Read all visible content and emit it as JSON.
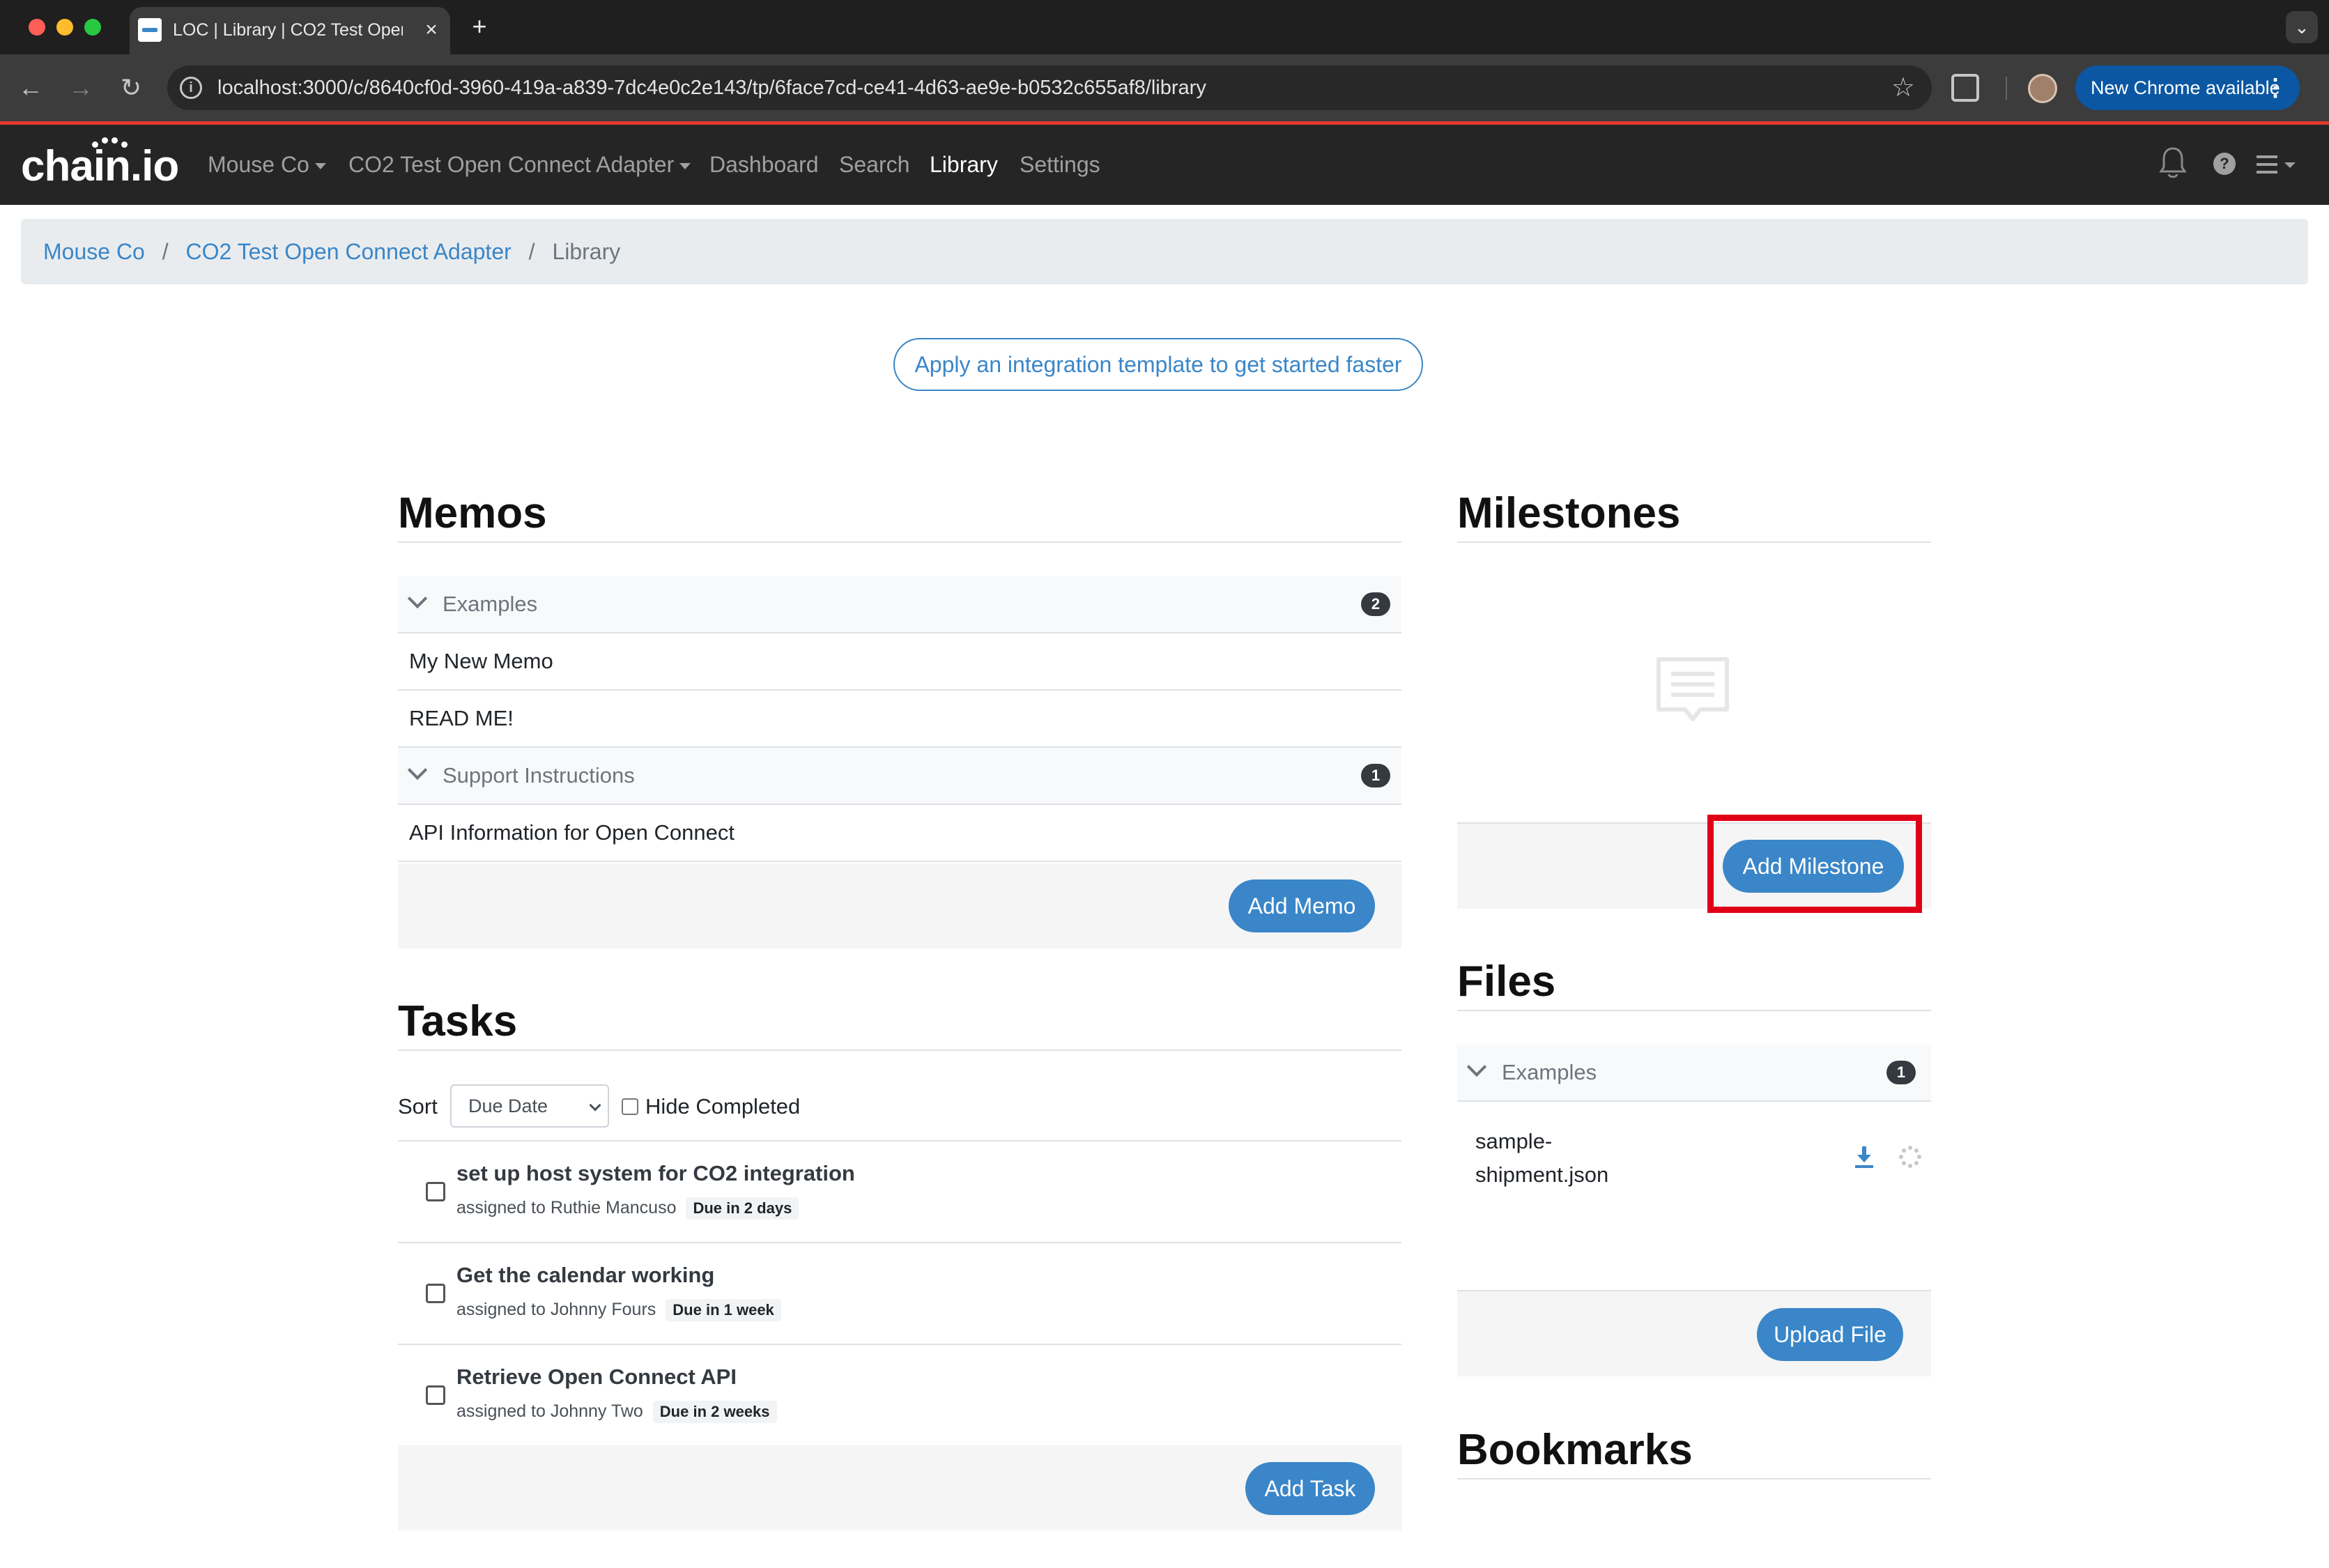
{
  "browser": {
    "tab_title": "LOC | Library | CO2 Test Open Connect Adapter",
    "tab_close": "×",
    "new_tab": "+",
    "tab_search": "⌄",
    "url": "localhost:3000/c/8640cf0d-3960-419a-a839-7dc4e0c2e143/tp/6face7cd-ce41-4d63-ae9e-b0532c655af8/library",
    "new_chrome_label": "New Chrome available",
    "new_chrome_dots": "⋮"
  },
  "navbar": {
    "logo": "chain.io",
    "company": "Mouse Co",
    "partner": "CO2 Test Open Connect Adapter",
    "links": [
      "Dashboard",
      "Search",
      "Library",
      "Settings"
    ],
    "active_link": "Library",
    "help_glyph": "?"
  },
  "breadcrumb": {
    "items": [
      "Mouse Co",
      "CO2 Test Open Connect Adapter"
    ],
    "separator": "/",
    "current": "Library"
  },
  "template_button": "Apply an integration template to get started faster",
  "memos": {
    "heading": "Memos",
    "groups": [
      {
        "label": "Examples",
        "count": "2",
        "items": [
          "My New Memo",
          "READ ME!"
        ]
      },
      {
        "label": "Support Instructions",
        "count": "1",
        "items": [
          "API Information for Open Connect"
        ]
      }
    ],
    "add_button": "Add Memo"
  },
  "tasks": {
    "heading": "Tasks",
    "sort_label": "Sort",
    "sort_value": "Due Date",
    "hide_completed_label": "Hide Completed",
    "items": [
      {
        "title": "set up host system for CO2 integration",
        "assigned": "assigned to Ruthie Mancuso",
        "due": "Due in 2 days"
      },
      {
        "title": "Get the calendar working",
        "assigned": "assigned to Johnny Fours",
        "due": "Due in 1 week"
      },
      {
        "title": "Retrieve Open Connect API",
        "assigned": "assigned to Johnny Two",
        "due": "Due in 2 weeks"
      }
    ],
    "add_button": "Add Task"
  },
  "milestones": {
    "heading": "Milestones",
    "add_button": "Add Milestone"
  },
  "files": {
    "heading": "Files",
    "group_label": "Examples",
    "group_count": "1",
    "file_name": "sample-shipment.json",
    "upload_button": "Upload File"
  },
  "bookmarks": {
    "heading": "Bookmarks"
  },
  "colors": {
    "accent": "#3a86c8",
    "navbar_bg": "#252525",
    "highlight": "#e00018"
  }
}
